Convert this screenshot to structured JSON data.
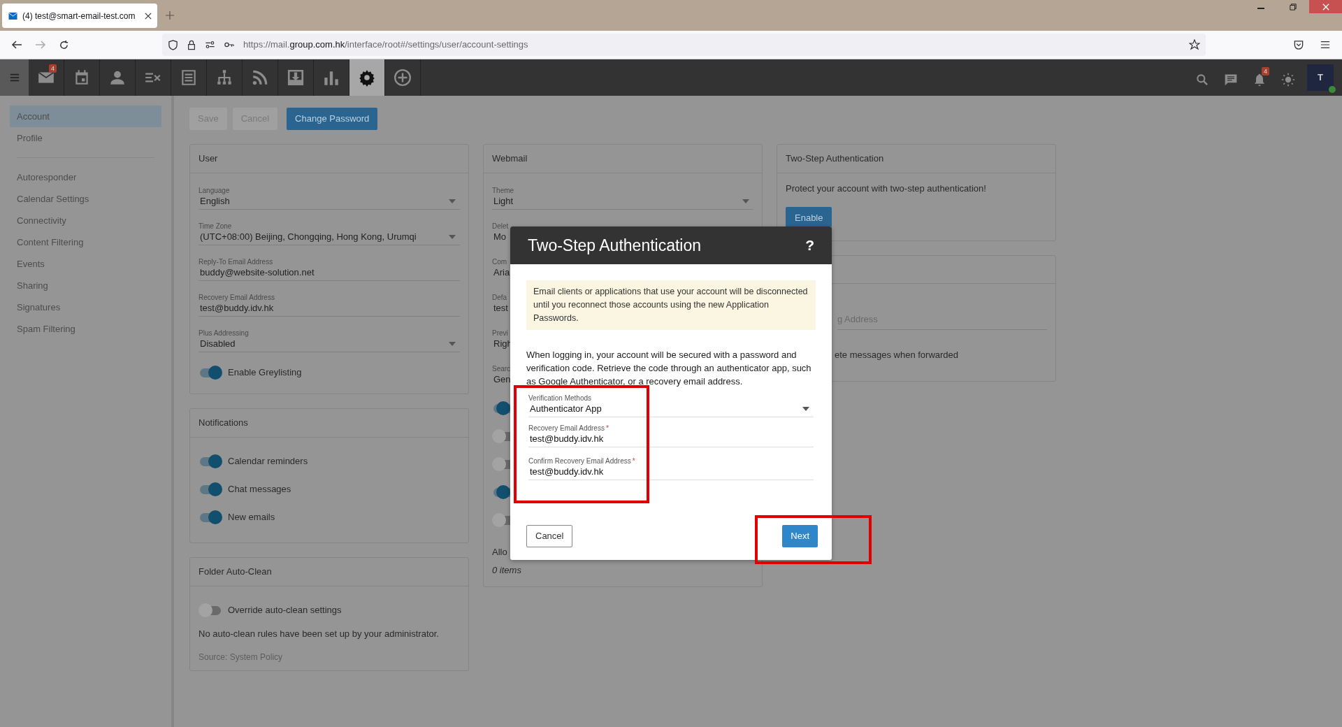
{
  "browser": {
    "tab_title": "(4) test@smart-email-test.com",
    "url_prefix": "https://mail.",
    "url_domain": "group.com.hk",
    "url_path": "/interface/root#/settings/user/account-settings"
  },
  "app_nav": {
    "items": [
      {
        "selected": false,
        "badge": "4"
      },
      {
        "selected": false
      },
      {
        "selected": false
      },
      {
        "selected": false
      },
      {
        "selected": false
      },
      {
        "selected": false
      },
      {
        "selected": false
      },
      {
        "selected": false
      },
      {
        "selected": false
      },
      {
        "selected": true
      },
      {
        "selected": false
      }
    ],
    "bell_badge": "4",
    "avatar": {
      "initial": "T",
      "online": true
    }
  },
  "sidebar": {
    "groups": [
      [
        {
          "label": "Account",
          "selected": true
        },
        {
          "label": "Profile",
          "selected": false
        }
      ],
      [
        {
          "label": "Autoresponder",
          "selected": false
        },
        {
          "label": "Calendar Settings",
          "selected": false
        },
        {
          "label": "Connectivity",
          "selected": false
        },
        {
          "label": "Content Filtering",
          "selected": false
        },
        {
          "label": "Events",
          "selected": false
        },
        {
          "label": "Sharing",
          "selected": false
        },
        {
          "label": "Signatures",
          "selected": false
        },
        {
          "label": "Spam Filtering",
          "selected": false
        }
      ]
    ]
  },
  "toolbar": [
    {
      "label": "Save",
      "disabled": true,
      "primary": false
    },
    {
      "label": "Cancel",
      "disabled": true,
      "primary": false
    },
    {
      "label": "Change Password",
      "disabled": false,
      "primary": true
    }
  ],
  "user_card": {
    "title": "User",
    "fields": [
      {
        "kind": "select",
        "label": "Language",
        "value": "English"
      },
      {
        "kind": "select",
        "label": "Time Zone",
        "value": "(UTC+08:00) Beijing, Chongqing, Hong Kong, Urumqi"
      },
      {
        "kind": "text",
        "label": "Reply-To Email Address",
        "value": "buddy@website-solution.net"
      },
      {
        "kind": "text",
        "label": "Recovery Email Address",
        "value": "test@buddy.idv.hk"
      },
      {
        "kind": "select",
        "label": "Plus Addressing",
        "value": "Disabled"
      }
    ],
    "toggles": [
      {
        "label": "Enable Greylisting",
        "on": true
      }
    ]
  },
  "notifications_card": {
    "title": "Notifications",
    "toggles": [
      {
        "label": "Calendar reminders",
        "on": true
      },
      {
        "label": "Chat messages",
        "on": true
      },
      {
        "label": "New emails",
        "on": true
      }
    ]
  },
  "auto_clean_card": {
    "title": "Folder Auto-Clean",
    "toggles": [
      {
        "label": "Override auto-clean settings",
        "on": false
      }
    ],
    "note": "No auto-clean rules have been set up by your administrator.",
    "source": "Source: System Policy"
  },
  "webmail_card": {
    "title": "Webmail",
    "theme": {
      "label": "Theme",
      "value": "Light"
    },
    "fragments": [
      {
        "label": "Delet",
        "value": "Mo"
      },
      {
        "label": "Com",
        "value": "Aria"
      },
      {
        "label": "Defa",
        "value": "test"
      },
      {
        "label": "Previ",
        "value": "Righ"
      },
      {
        "label": "Searc",
        "value": "Gen"
      }
    ],
    "toggles": [
      {
        "on": true
      },
      {
        "on": false
      },
      {
        "on": false
      },
      {
        "on": true
      },
      {
        "on": false
      }
    ],
    "list_label": "Allo",
    "list_count": "0 items"
  },
  "two_step_card": {
    "title": "Two-Step Authentication",
    "text": "Protect your account with two-step authentication!",
    "button": "Enable"
  },
  "forwarding_card": {
    "placeholder": "g Address",
    "toggle_text": "ete messages when forwarded"
  },
  "dialog": {
    "title": "Two-Step Authentication",
    "help": "?",
    "notice": "Email clients or applications that use your account will be disconnected until you reconnect those accounts using the new Application Passwords.",
    "body": "When logging in, your account will be secured with a password and verification code. Retrieve the code through an authenticator app, such as Google Authenticator, or a recovery email address.",
    "fields_highlighted": true,
    "required_mark": "*",
    "fields": [
      {
        "kind": "select",
        "label": "Verification Methods",
        "value": "Authenticator App",
        "required": false
      },
      {
        "kind": "text",
        "label": "Recovery Email Address",
        "value": "test@buddy.idv.hk",
        "required": true
      },
      {
        "kind": "text",
        "label": "Confirm Recovery Email Address",
        "value": "test@buddy.idv.hk",
        "required": true
      }
    ],
    "cancel": "Cancel",
    "next": {
      "label": "Next",
      "highlighted": true
    }
  }
}
